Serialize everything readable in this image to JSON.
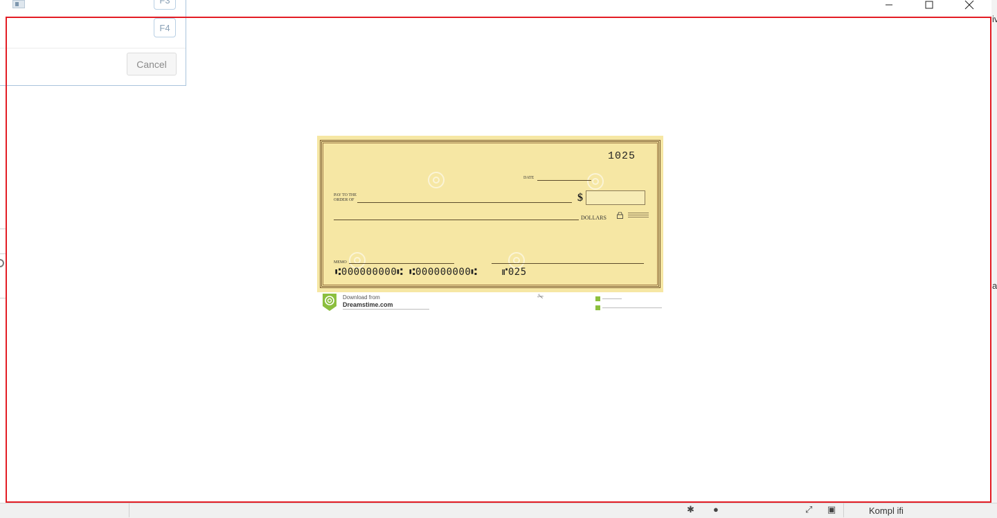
{
  "window": {
    "minimize_icon": "minimize-icon",
    "maximize_icon": "maximize-icon",
    "close_icon": "close-icon"
  },
  "dialog": {
    "keys": [
      "F3",
      "F4"
    ],
    "cancel_label": "Cancel"
  },
  "background": {
    "right_chars": [
      "iv",
      "a"
    ],
    "bottom_text": "Kompl ifi"
  },
  "cheque": {
    "number": "1025",
    "date_label": "DATE",
    "pay_to_label_1": "PAY TO THE",
    "pay_to_label_2": "ORDER OF",
    "currency_symbol": "$",
    "dollars_label": "DOLLARS",
    "memo_label": "MEMO",
    "micr_line": "⑆000000000⑆ ⑆000000000⑆    ⑈025",
    "footer_download": "Download from",
    "footer_site": "Dreamstime.com",
    "colors": {
      "paper": "#f6e7a4",
      "border": "#7a5a2e",
      "logo": "#8cbf3f"
    }
  },
  "selection_frame_color": "#e31b23"
}
